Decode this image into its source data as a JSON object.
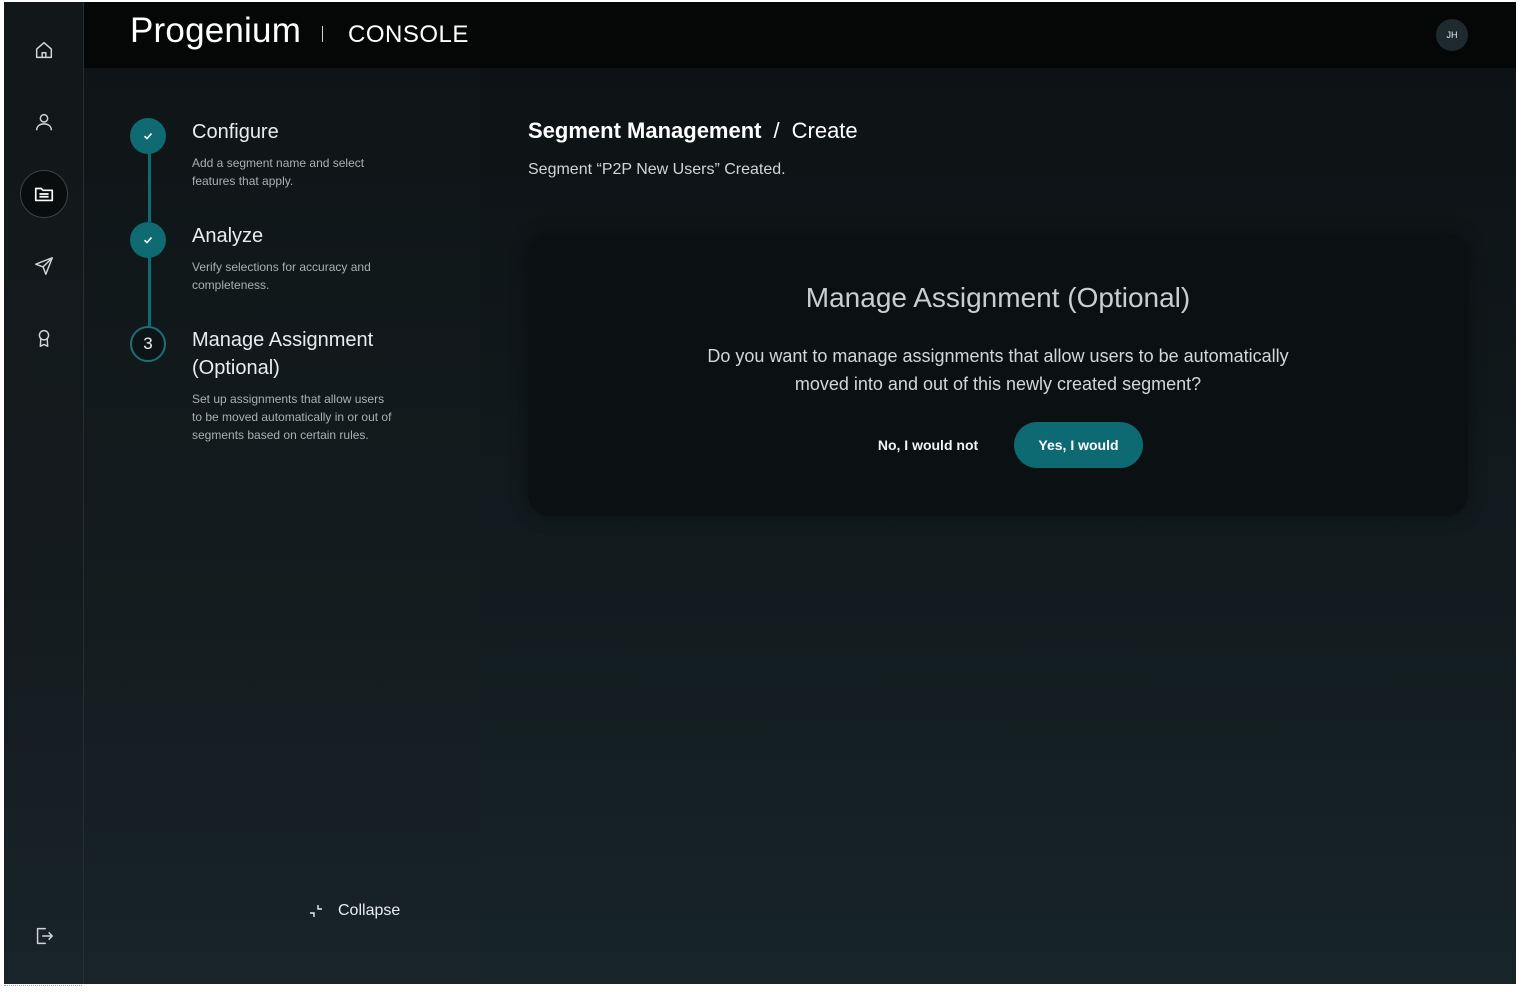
{
  "header": {
    "brand": "Progenium",
    "section": "CONSOLE",
    "avatar_initials": "JH"
  },
  "rail": {
    "icons": [
      "home-icon",
      "user-icon",
      "folder-icon",
      "send-icon",
      "award-icon"
    ],
    "active": "folder-icon",
    "bottom_icon": "logout-icon"
  },
  "stepper": {
    "steps": [
      {
        "title": "Configure",
        "description": "Add a segment name and select features that apply.",
        "state": "done"
      },
      {
        "title": "Analyze",
        "description": "Verify selections for accuracy and completeness.",
        "state": "done"
      },
      {
        "number": "3",
        "title": "Manage Assignment (Optional)",
        "description": "Set up assignments that allow users to be moved automatically in or out of segments based on certain rules.",
        "state": "current"
      }
    ],
    "collapse_label": "Collapse"
  },
  "main": {
    "breadcrumb": {
      "parent": "Segment Management",
      "separator": "/",
      "current": "Create"
    },
    "status": "Segment “P2P New Users” Created.",
    "card": {
      "title": "Manage Assignment (Optional)",
      "question": "Do you want to manage assignments that allow users to be automatically moved into and out of this newly created segment?",
      "no_label": "No, I would not",
      "yes_label": "Yes, I would"
    }
  },
  "colors": {
    "accent": "#0d6a73",
    "topbar": "#050606",
    "card": "#0b1012"
  }
}
